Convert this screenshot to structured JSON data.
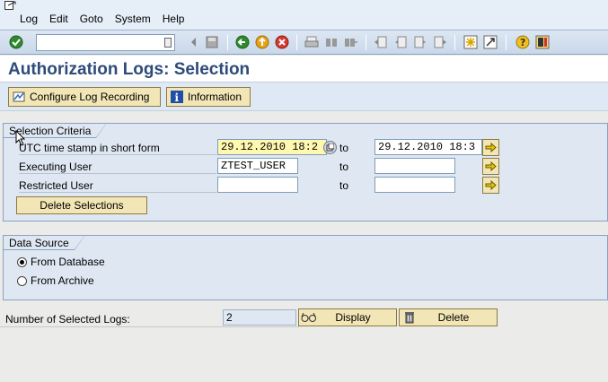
{
  "menubar": {
    "items": [
      "Log",
      "Edit",
      "Goto",
      "System",
      "Help"
    ]
  },
  "toolbar": {
    "command_value": "",
    "icons": [
      "enter-icon",
      "back-icon",
      "exit-icon",
      "cancel-icon",
      "print-icon",
      "find-icon",
      "find-next-icon",
      "first-page-icon",
      "prev-page-icon",
      "next-page-icon",
      "last-page-icon",
      "new-session-icon",
      "shortcut-icon",
      "help-icon",
      "layout-icon"
    ]
  },
  "title": "Authorization Logs: Selection",
  "app_toolbar": {
    "configure_label": "Configure Log Recording",
    "information_label": "Information"
  },
  "selection": {
    "title": "Selection Criteria",
    "utc_label": "UTC time stamp in short form",
    "utc_from": "29.12.2010  18:2",
    "utc_to": "29.12.2010  18:3",
    "user_label": "Executing User",
    "user_from": "ZTEST_USER",
    "user_to": "",
    "restricted_label": "Restricted User",
    "restricted_from": "",
    "restricted_to": "",
    "to_label": "to",
    "delete_selections_label": "Delete Selections"
  },
  "data_source": {
    "title": "Data Source",
    "from_database": "From Database",
    "from_archive": "From Archive",
    "selected": "From Database"
  },
  "results": {
    "count_label": "Number of Selected Logs:",
    "count_value": "2",
    "display_label": "Display",
    "delete_label": "Delete"
  },
  "colors": {
    "title": "#2e4b7a",
    "button": "#f2e6b6",
    "group_bg": "#dfe8f2",
    "highlight_input": "#fff8b0"
  }
}
